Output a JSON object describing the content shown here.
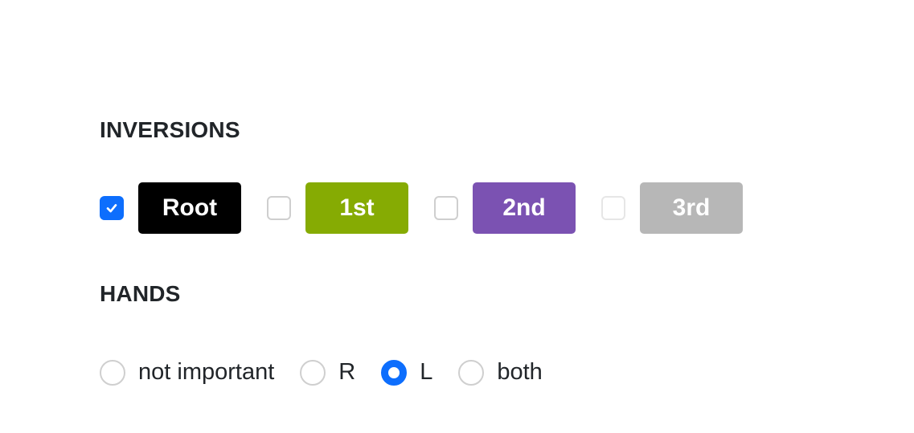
{
  "inversions": {
    "title": "INVERSIONS",
    "items": [
      {
        "label": "Root",
        "checked": true,
        "disabled": false,
        "color": "#000000"
      },
      {
        "label": "1st",
        "checked": false,
        "disabled": false,
        "color": "#86ab03"
      },
      {
        "label": "2nd",
        "checked": false,
        "disabled": false,
        "color": "#7b52b2"
      },
      {
        "label": "3rd",
        "checked": false,
        "disabled": true,
        "color": "#b7b7b7"
      }
    ]
  },
  "hands": {
    "title": "HANDS",
    "selected": "L",
    "options": [
      {
        "label": "not important",
        "checked": false
      },
      {
        "label": "R",
        "checked": false
      },
      {
        "label": "L",
        "checked": true
      },
      {
        "label": "both",
        "checked": false
      }
    ]
  },
  "colors": {
    "accent": "#0d6efd",
    "text": "#212529"
  }
}
